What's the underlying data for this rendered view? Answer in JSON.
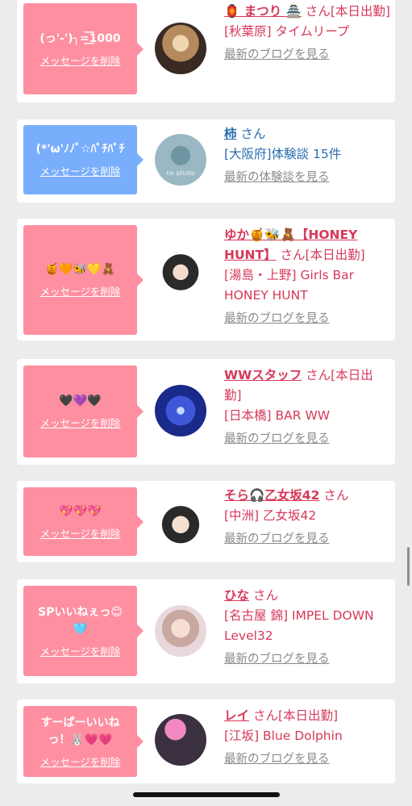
{
  "items": [
    {
      "message": "(っ'-')╮=͟͟͞͞1000",
      "delete_label": "メッセージを削除",
      "name": "🏮 まつり 🏯",
      "suffix": "さん[本日出勤]",
      "shop": "[秋葉原] タイムリープ",
      "link": "最新のブログを見る",
      "bubble_color": "#fe8fa1"
    },
    {
      "message": "(*'ω'ﾉﾉﾞ☆ﾊﾟﾁﾊﾟﾁ",
      "delete_label": "メッセージを削除",
      "name": "柿",
      "suffix": "さん",
      "shop": "[大阪府]体験談 15件",
      "link": "最新の体験談を見る",
      "bubble_color": "#79aefc",
      "avatar_text": "no photo"
    },
    {
      "message": "🍯🧡🐝💛🧸",
      "delete_label": "メッセージを削除",
      "name": "ゆか🍯🐝🧸【HONEY HUNT】",
      "suffix": "さん[本日出勤]",
      "shop": "[湯島・上野] Girls Bar HONEY HUNT",
      "link": "最新のブログを見る",
      "bubble_color": "#fe8fa1"
    },
    {
      "message": "🖤💜🖤",
      "delete_label": "メッセージを削除",
      "name": "WWスタッフ",
      "suffix": "さん[本日出勤]",
      "shop": "[日本橋] BAR WW",
      "link": "最新のブログを見る",
      "bubble_color": "#fe8fa1"
    },
    {
      "message": "💖💖💖",
      "delete_label": "メッセージを削除",
      "name": "そら🎧乙女坂42",
      "suffix": "さん",
      "shop": "[中洲] 乙女坂42",
      "link": "最新のブログを見る",
      "bubble_color": "#fe8fa1"
    },
    {
      "message": "SPいいねぇっ😊\n🩵",
      "delete_label": "メッセージを削除",
      "name": "ひな",
      "suffix": "さん",
      "shop": "[名古屋 錦] IMPEL DOWN Level32",
      "link": "最新のブログを見る",
      "bubble_color": "#fe8fa1"
    },
    {
      "message": "すーぱーいいね\nっ！🐰💗💗",
      "delete_label": "メッセージを削除",
      "name": "レイ",
      "suffix": "さん[本日出勤]",
      "shop": "[江坂] Blue Dolphin",
      "link": "最新のブログを見る",
      "bubble_color": "#fe8fa1"
    }
  ]
}
